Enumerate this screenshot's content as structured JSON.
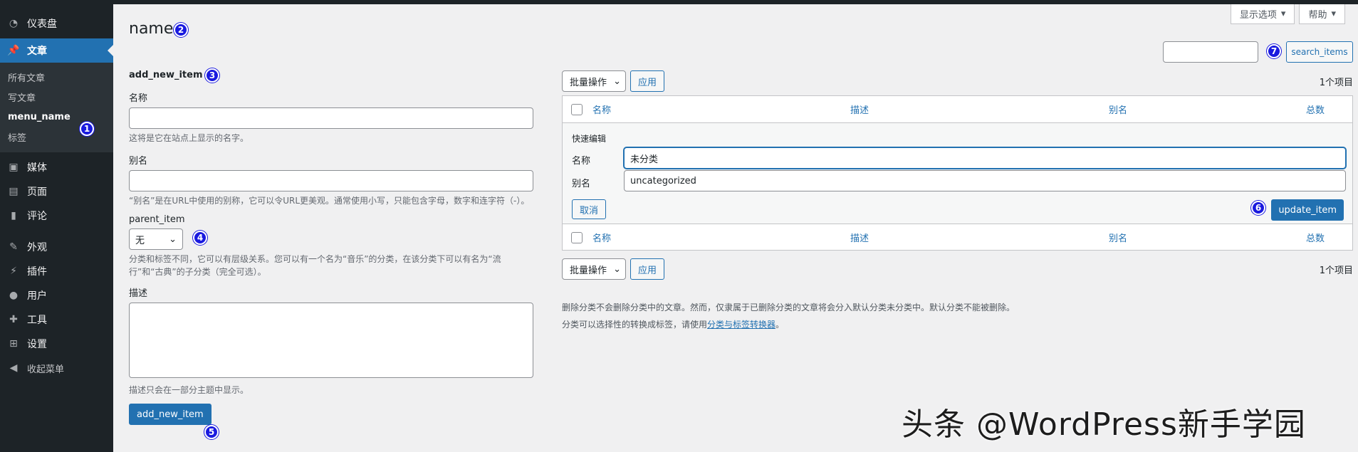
{
  "sidebar": {
    "items": [
      {
        "label": "仪表盘",
        "icon": "dashboard-icon"
      },
      {
        "label": "文章",
        "icon": "pin-icon"
      },
      {
        "label": "媒体",
        "icon": "media-icon"
      },
      {
        "label": "页面",
        "icon": "page-icon"
      },
      {
        "label": "评论",
        "icon": "comment-icon"
      },
      {
        "label": "外观",
        "icon": "brush-icon"
      },
      {
        "label": "插件",
        "icon": "plugin-icon"
      },
      {
        "label": "用户",
        "icon": "user-icon"
      },
      {
        "label": "工具",
        "icon": "wrench-icon"
      },
      {
        "label": "设置",
        "icon": "settings-icon"
      },
      {
        "label": "收起菜单",
        "icon": "collapse-icon"
      }
    ],
    "submenu": [
      "所有文章",
      "写文章",
      "menu_name",
      "标签"
    ]
  },
  "topright": {
    "screen_options": "显示选项",
    "help": "帮助"
  },
  "page": {
    "title": "name"
  },
  "form": {
    "heading": "add_new_item",
    "name_label": "名称",
    "name_help": "这将是它在站点上显示的名字。",
    "slug_label": "别名",
    "slug_help": "“别名”是在URL中使用的别称，它可以令URL更美观。通常使用小写，只能包含字母，数字和连字符（-）。",
    "parent_label": "parent_item",
    "parent_value": "无",
    "parent_help": "分类和标签不同，它可以有层级关系。您可以有一个名为“音乐”的分类，在该分类下可以有名为“流行”和“古典”的子分类（完全可选）。",
    "desc_label": "描述",
    "desc_help": "描述只会在一部分主题中显示。",
    "submit": "add_new_item"
  },
  "search": {
    "button": "search_items"
  },
  "tablenav": {
    "bulk": "批量操作",
    "apply": "应用",
    "count": "1个项目"
  },
  "table": {
    "columns": [
      "名称",
      "描述",
      "别名",
      "总数"
    ]
  },
  "quick_edit": {
    "title": "快速编辑",
    "name_label": "名称",
    "name_value": "未分类",
    "slug_label": "别名",
    "slug_value": "uncategorized",
    "cancel": "取消",
    "update": "update_item"
  },
  "notes": {
    "line1": "删除分类不会删除分类中的文章。然而，仅隶属于已删除分类的文章将会分入默认分类未分类中。默认分类不能被删除。",
    "line2_prefix": "分类可以选择性的转换成标签，请使用",
    "line2_link": "分类与标签转换器",
    "line2_suffix": "。"
  },
  "badges": [
    "1",
    "2",
    "3",
    "4",
    "5",
    "6",
    "7"
  ],
  "watermark": "头条 @WordPress新手学园",
  "colors": {
    "accent": "#2271b1",
    "sidebar": "#1d2327",
    "badge": "#1a1adf"
  }
}
